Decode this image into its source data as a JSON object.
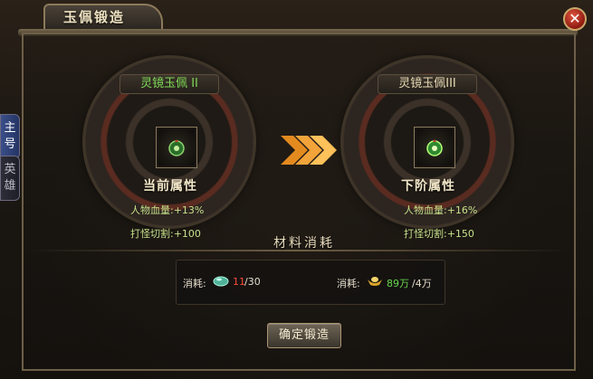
{
  "window": {
    "title": "玉佩锻造",
    "close_glyph": "✕"
  },
  "side_tabs": [
    {
      "label": "主号",
      "active": true
    },
    {
      "label": "英雄",
      "active": false
    }
  ],
  "current": {
    "item_name": "灵镜玉佩 II",
    "section_label": "当前属性",
    "stats": [
      {
        "text": "人物血量:+13%"
      },
      {
        "text": "打怪切割:+100"
      }
    ]
  },
  "next": {
    "item_name": "灵镜玉佩III",
    "section_label": "下阶属性",
    "stats": [
      {
        "text": "人物血量:+16%"
      },
      {
        "text": "打怪切割:+150"
      }
    ]
  },
  "materials": {
    "title": "材料消耗",
    "items": [
      {
        "label": "消耗:",
        "icon": "jade-stone-icon",
        "have": "11",
        "need": "/30",
        "status_color": "#ff4b3a"
      },
      {
        "label": "消耗:",
        "icon": "gold-ingot-icon",
        "have": "89万",
        "need": "/4万",
        "status_color": "#68d84d"
      }
    ]
  },
  "confirm_button": "确定锻造",
  "colors": {
    "current_name": "#7ed957",
    "stat_text": "#c6e08a",
    "arrow": "#f0a030"
  }
}
